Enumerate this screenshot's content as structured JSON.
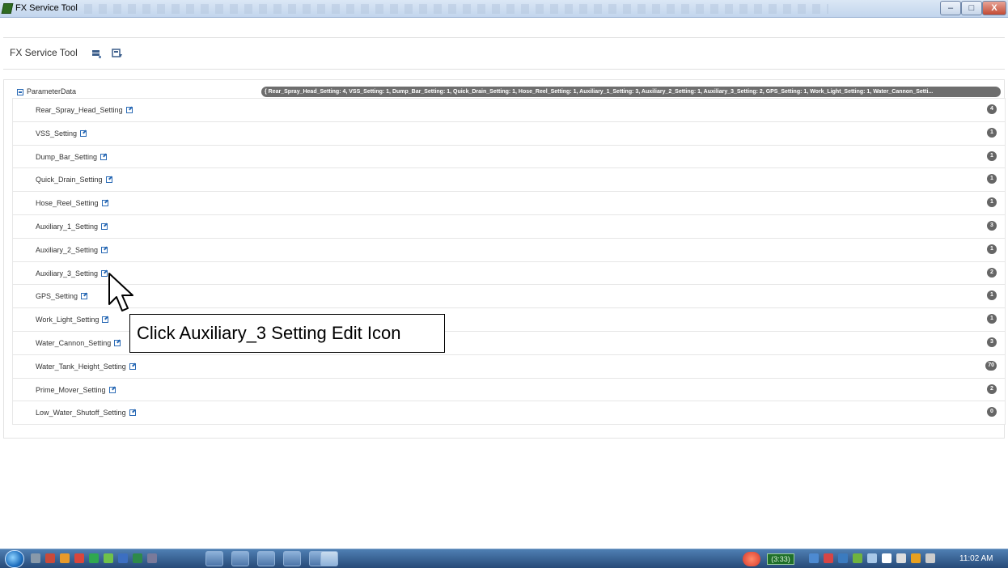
{
  "window": {
    "title": "FX Service Tool",
    "controls": {
      "minimize": "–",
      "maximize": "□",
      "close": "X"
    }
  },
  "header": {
    "title": "FX Service Tool",
    "icons": [
      "connect-icon",
      "download-icon"
    ]
  },
  "tree": {
    "root_label": "ParameterData",
    "root_summary": "{ Rear_Spray_Head_Setting: 4, VSS_Setting: 1, Dump_Bar_Setting: 1, Quick_Drain_Setting: 1, Hose_Reel_Setting: 1, Auxiliary_1_Setting: 3, Auxiliary_2_Setting: 1, Auxiliary_3_Setting: 2, GPS_Setting: 1, Work_Light_Setting: 1, Water_Cannon_Setti...",
    "items": [
      {
        "label": "Rear_Spray_Head_Setting",
        "value": "4"
      },
      {
        "label": "VSS_Setting",
        "value": "1"
      },
      {
        "label": "Dump_Bar_Setting",
        "value": "1"
      },
      {
        "label": "Quick_Drain_Setting",
        "value": "1"
      },
      {
        "label": "Hose_Reel_Setting",
        "value": "1"
      },
      {
        "label": "Auxiliary_1_Setting",
        "value": "3"
      },
      {
        "label": "Auxiliary_2_Setting",
        "value": "1"
      },
      {
        "label": "Auxiliary_3_Setting",
        "value": "2"
      },
      {
        "label": "GPS_Setting",
        "value": "1"
      },
      {
        "label": "Work_Light_Setting",
        "value": "1"
      },
      {
        "label": "Water_Cannon_Setting",
        "value": "3"
      },
      {
        "label": "Water_Tank_Height_Setting",
        "value": "70"
      },
      {
        "label": "Prime_Mover_Setting",
        "value": "2"
      },
      {
        "label": "Low_Water_Shutoff_Setting",
        "value": "0"
      }
    ]
  },
  "callout": {
    "text": "Click Auxiliary_3 Setting Edit Icon"
  },
  "taskbar": {
    "battery": "(3:33)",
    "clock": "11:02 AM"
  },
  "colors": {
    "badge": "#666666",
    "accent": "#2a6ab5",
    "taskbar": "#274a78"
  }
}
